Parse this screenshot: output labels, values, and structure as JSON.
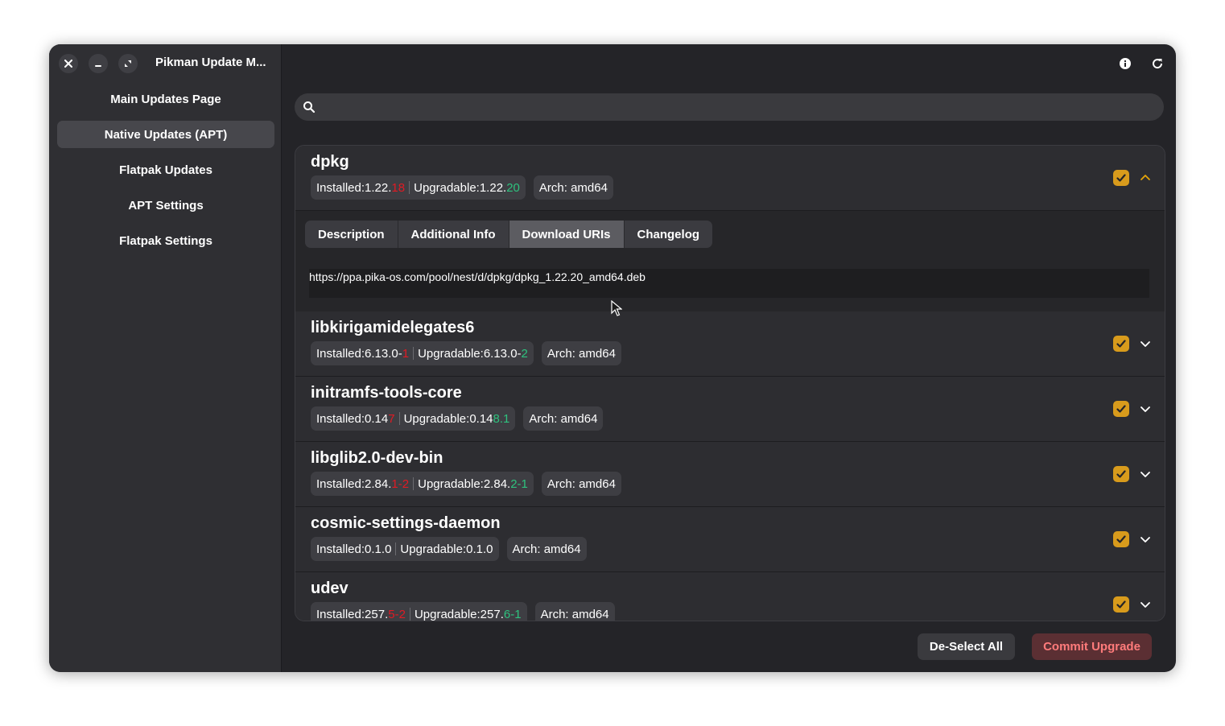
{
  "window": {
    "title": "Pikman Update M..."
  },
  "sidebar": {
    "items": [
      {
        "label": "Main Updates Page",
        "active": false
      },
      {
        "label": "Native Updates (APT)",
        "active": true
      },
      {
        "label": "Flatpak Updates",
        "active": false
      },
      {
        "label": "APT Settings",
        "active": false
      },
      {
        "label": "Flatpak Settings",
        "active": false
      }
    ]
  },
  "header": {
    "icons": [
      "info-icon",
      "refresh-icon"
    ]
  },
  "search": {
    "value": "",
    "placeholder": ""
  },
  "detail": {
    "tabs": [
      "Description",
      "Additional Info",
      "Download URIs",
      "Changelog"
    ],
    "active_tab": "Download URIs",
    "uri": "https://ppa.pika-os.com/pool/nest/d/dpkg/dpkg_1.22.20_amd64.deb"
  },
  "packages": [
    {
      "name": "dpkg",
      "expanded": true,
      "checked": true,
      "installed_label": "Installed: ",
      "installed_common": "1.22.",
      "installed_diff": "18",
      "upgradable_label": "Upgradable: ",
      "upgradable_common": "1.22.",
      "upgradable_diff": "20",
      "arch": "Arch: amd64"
    },
    {
      "name": "libkirigamidelegates6",
      "expanded": false,
      "checked": true,
      "installed_label": "Installed: ",
      "installed_common": "6.13.0-",
      "installed_diff": "1",
      "upgradable_label": "Upgradable: ",
      "upgradable_common": "6.13.0-",
      "upgradable_diff": "2",
      "arch": "Arch: amd64"
    },
    {
      "name": "initramfs-tools-core",
      "expanded": false,
      "checked": true,
      "installed_label": "Installed: ",
      "installed_common": "0.14",
      "installed_diff": "7",
      "upgradable_label": "Upgradable: ",
      "upgradable_common": "0.14",
      "upgradable_diff": "8.1",
      "arch": "Arch: amd64"
    },
    {
      "name": "libglib2.0-dev-bin",
      "expanded": false,
      "checked": true,
      "installed_label": "Installed: ",
      "installed_common": "2.84.",
      "installed_diff": "1-2",
      "upgradable_label": "Upgradable: ",
      "upgradable_common": "2.84.",
      "upgradable_diff": "2-1",
      "arch": "Arch: amd64"
    },
    {
      "name": "cosmic-settings-daemon",
      "expanded": false,
      "checked": true,
      "installed_label": "Installed: ",
      "installed_common": "0.1.0",
      "installed_diff": "",
      "upgradable_label": "Upgradable: ",
      "upgradable_common": "0.1.0",
      "upgradable_diff": "",
      "arch": "Arch: amd64"
    },
    {
      "name": "udev",
      "expanded": false,
      "checked": true,
      "installed_label": "Installed: ",
      "installed_common": "257.",
      "installed_diff": "5-2",
      "upgradable_label": "Upgradable: ",
      "upgradable_common": "257.",
      "upgradable_diff": "6-1",
      "arch": "Arch: amd64"
    }
  ],
  "footer": {
    "deselect_label": "De-Select All",
    "commit_label": "Commit Upgrade"
  },
  "colors": {
    "accent_checkbox": "#d89b1c",
    "version_old": "#e01b24",
    "version_new": "#2ec27e",
    "commit_text": "#ff7b7b"
  }
}
